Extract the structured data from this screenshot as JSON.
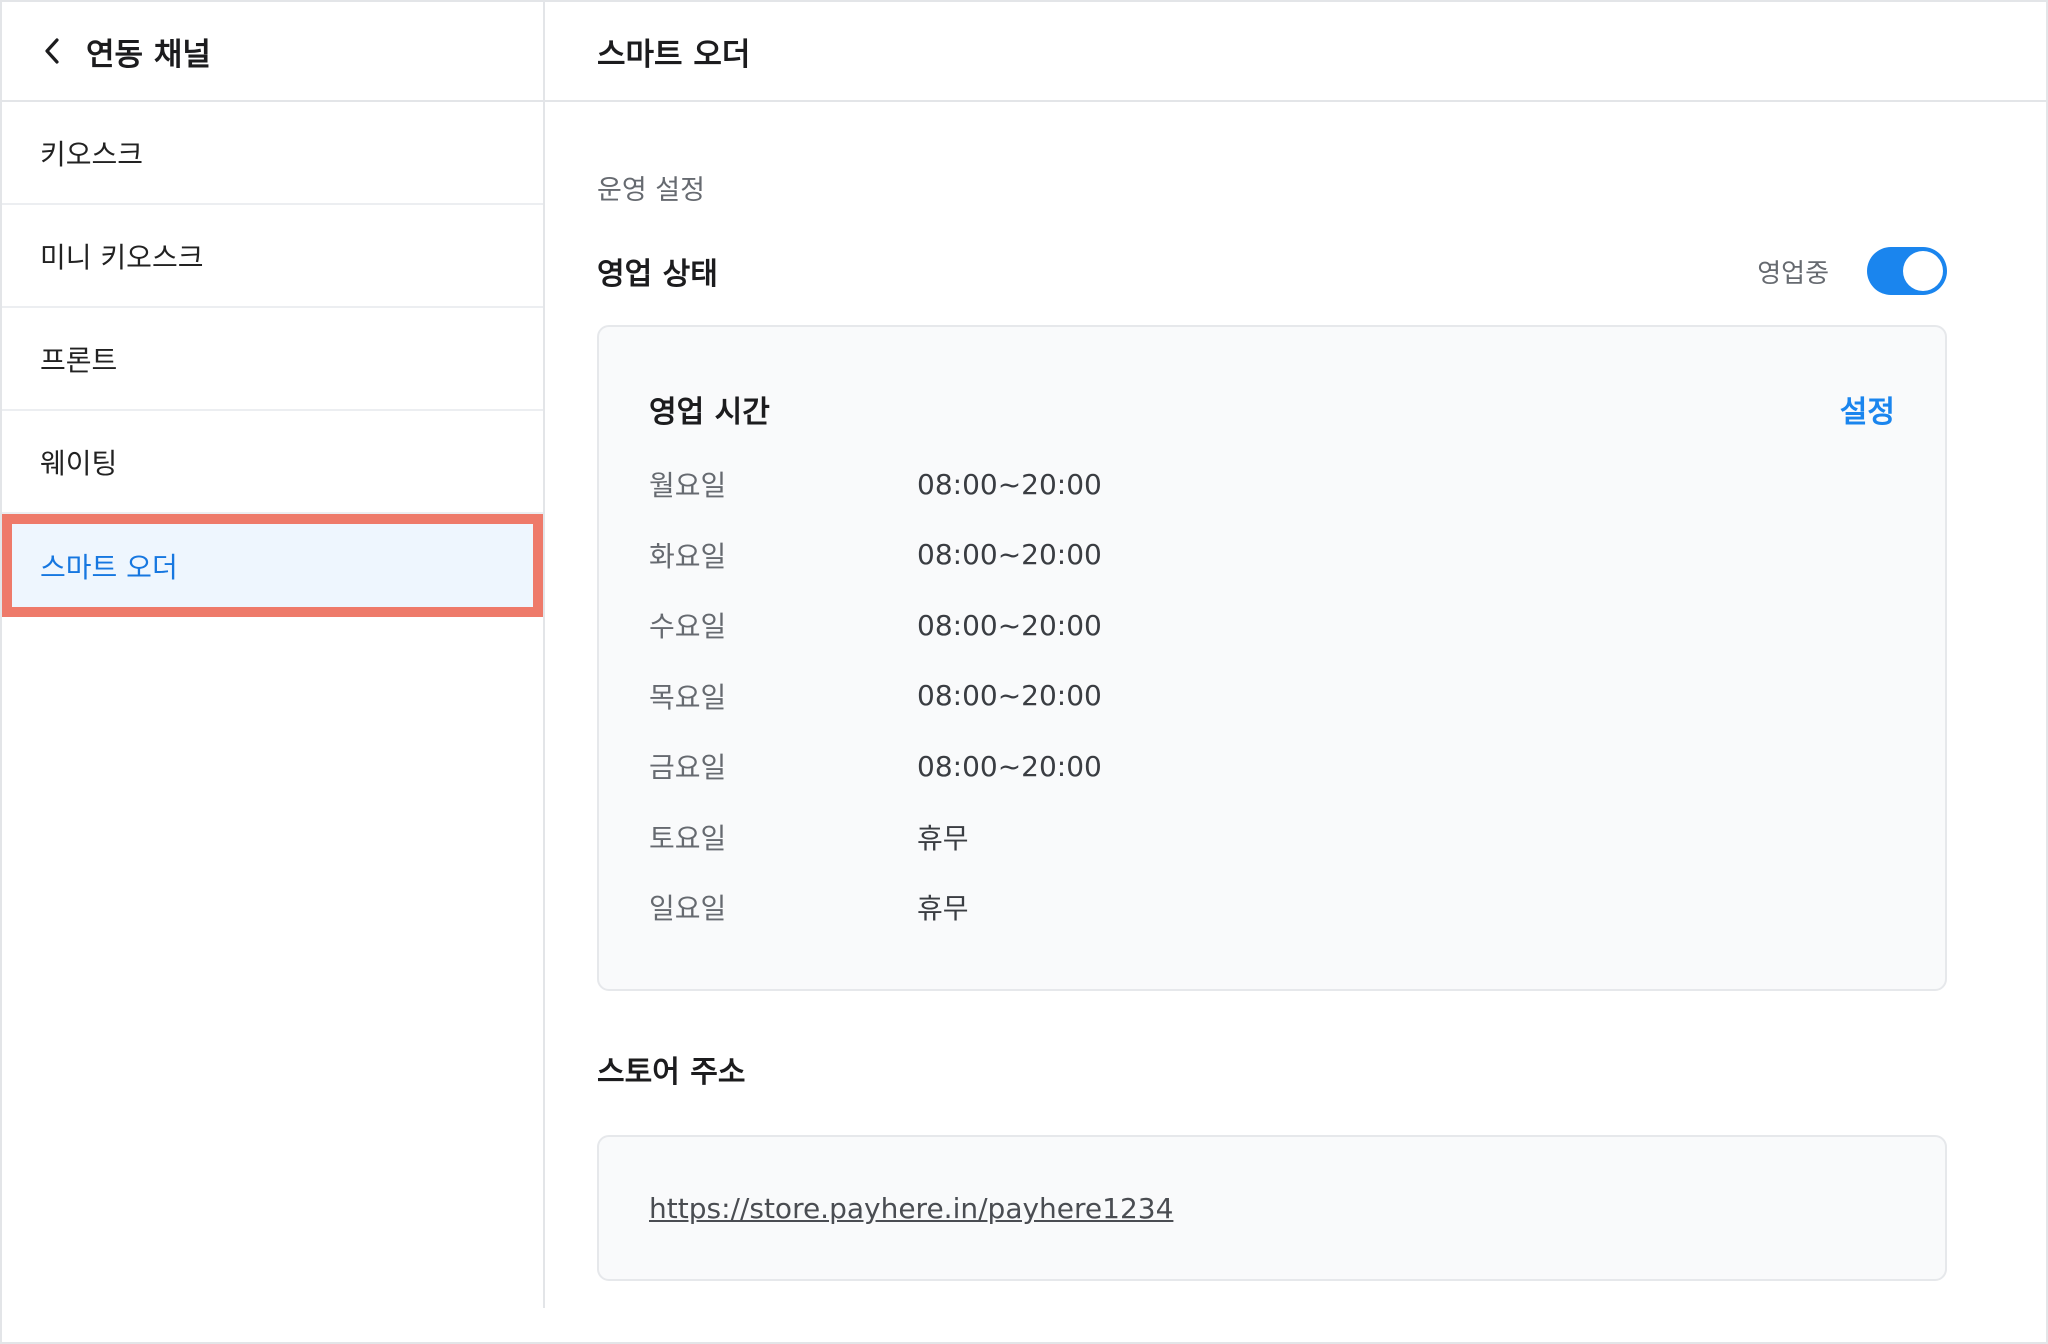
{
  "sidebar": {
    "title": "연동 채널",
    "back_icon": "chevron-left-icon",
    "items": [
      {
        "label": "키오스크"
      },
      {
        "label": "미니 키오스크"
      },
      {
        "label": "프론트"
      },
      {
        "label": "웨이팅"
      },
      {
        "label": "스마트 오더",
        "active": true
      }
    ]
  },
  "main": {
    "title": "스마트 오더",
    "section_label": "운영 설정",
    "status": {
      "title": "영업 상태",
      "value_text": "영업중",
      "toggle_on": true
    },
    "hours": {
      "title": "영업 시간",
      "edit_label": "설정",
      "rows": [
        {
          "day": "월요일",
          "time": "08:00~20:00"
        },
        {
          "day": "화요일",
          "time": "08:00~20:00"
        },
        {
          "day": "수요일",
          "time": "08:00~20:00"
        },
        {
          "day": "목요일",
          "time": "08:00~20:00"
        },
        {
          "day": "금요일",
          "time": "08:00~20:00"
        },
        {
          "day": "토요일",
          "time": "휴무"
        },
        {
          "day": "일요일",
          "time": "휴무"
        }
      ]
    },
    "address": {
      "title": "스토어 주소",
      "url": "https://store.payhere.in/payhere1234"
    }
  },
  "colors": {
    "accent": "#1a85ee",
    "active_text": "#1677e0",
    "active_bg": "#eef6fe",
    "highlight_border": "#ee7a6a"
  }
}
